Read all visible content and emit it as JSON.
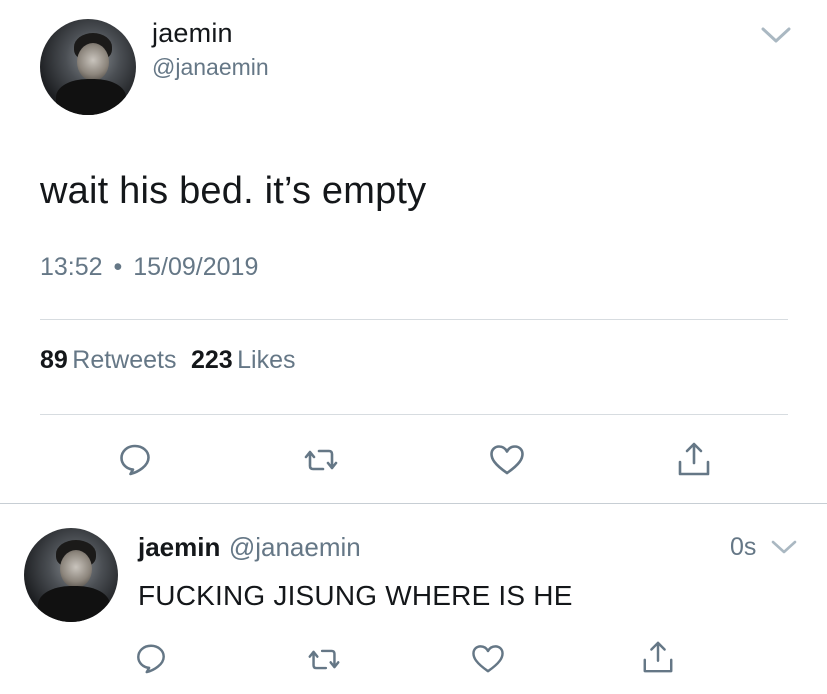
{
  "main_tweet": {
    "display_name": "jaemin",
    "handle": "@janaemin",
    "text": "wait his bed. it’s empty",
    "time": "13:52",
    "separator": "•",
    "date": "15/09/2019",
    "retweets_count": "89",
    "retweets_label": "Retweets",
    "likes_count": "223",
    "likes_label": "Likes"
  },
  "reply_tweet": {
    "display_name": "jaemin",
    "handle": "@janaemin",
    "time_ago": "0s",
    "text": "FUCKING JISUNG WHERE IS HE"
  },
  "icons": {
    "chevron": "chevron-down-icon",
    "reply": "reply-icon",
    "retweet": "retweet-icon",
    "like": "heart-icon",
    "share": "share-icon"
  },
  "colors": {
    "text_primary": "#14171a",
    "text_secondary": "#657786",
    "divider": "#d7dce0",
    "icon": "#657786"
  }
}
